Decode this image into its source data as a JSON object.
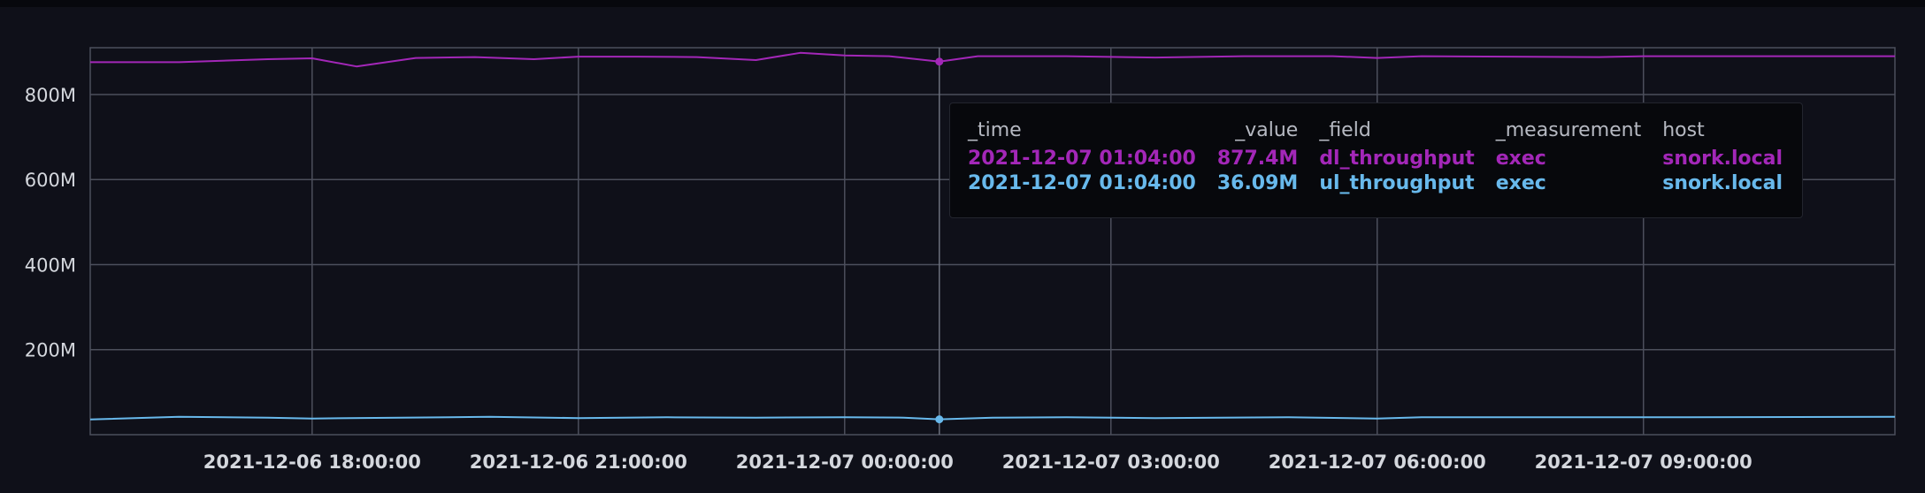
{
  "colors": {
    "background": "#0f1019",
    "grid": "#4c4f5c",
    "series_dl": "#a327b8",
    "series_ul": "#68b9ec",
    "tooltip_bg": "#07080c",
    "text": "#d4d7dd"
  },
  "tooltip": {
    "headers": [
      "_time",
      "_value",
      "_field",
      "_measurement",
      "host"
    ],
    "rows": [
      {
        "time": "2021-12-07 01:04:00",
        "value": "877.4M",
        "field": "dl_throughput",
        "measurement": "exec",
        "host": "snork.local"
      },
      {
        "time": "2021-12-07 01:04:00",
        "value": "36.09M",
        "field": "ul_throughput",
        "measurement": "exec",
        "host": "snork.local"
      }
    ]
  },
  "chart_data": {
    "type": "line",
    "title": "",
    "xlabel": "",
    "ylabel": "",
    "ylim": [
      0,
      910
    ],
    "xlim": [
      "2021-12-06 15:30:00",
      "2021-12-07 11:50:00"
    ],
    "y_ticks": [
      200,
      400,
      600,
      800
    ],
    "y_tick_labels": [
      "200M",
      "400M",
      "600M",
      "800M"
    ],
    "x_ticks": [
      "2021-12-06 18:00:00",
      "2021-12-06 21:00:00",
      "2021-12-07 00:00:00",
      "2021-12-07 03:00:00",
      "2021-12-07 06:00:00",
      "2021-12-07 09:00:00"
    ],
    "x_tick_labels": [
      "2021-12-06 18:00:00",
      "2021-12-06 21:00:00",
      "2021-12-07 00:00:00",
      "2021-12-07 03:00:00",
      "2021-12-07 06:00:00",
      "2021-12-07 09:00:00"
    ],
    "grid": true,
    "legend": "none",
    "hover_x": "2021-12-07 01:04:00",
    "series": [
      {
        "field": "dl_throughput",
        "color": "#a327b8",
        "points": [
          [
            "2021-12-06 15:30:00",
            876
          ],
          [
            "2021-12-06 16:30:00",
            876
          ],
          [
            "2021-12-06 17:30:00",
            883
          ],
          [
            "2021-12-06 18:00:00",
            885
          ],
          [
            "2021-12-06 18:30:00",
            866
          ],
          [
            "2021-12-06 19:10:00",
            886
          ],
          [
            "2021-12-06 19:50:00",
            888
          ],
          [
            "2021-12-06 20:30:00",
            883
          ],
          [
            "2021-12-06 21:00:00",
            889
          ],
          [
            "2021-12-06 21:40:00",
            889
          ],
          [
            "2021-12-06 22:20:00",
            888
          ],
          [
            "2021-12-06 23:00:00",
            881
          ],
          [
            "2021-12-06 23:30:00",
            898
          ],
          [
            "2021-12-07 00:00:00",
            892
          ],
          [
            "2021-12-07 00:30:00",
            890
          ],
          [
            "2021-12-07 01:04:00",
            877.4
          ],
          [
            "2021-12-07 01:30:00",
            890
          ],
          [
            "2021-12-07 02:30:00",
            890
          ],
          [
            "2021-12-07 03:30:00",
            887
          ],
          [
            "2021-12-07 04:30:00",
            890
          ],
          [
            "2021-12-07 05:30:00",
            890
          ],
          [
            "2021-12-07 06:00:00",
            886
          ],
          [
            "2021-12-07 06:30:00",
            890
          ],
          [
            "2021-12-07 07:30:00",
            889
          ],
          [
            "2021-12-07 08:30:00",
            888
          ],
          [
            "2021-12-07 09:00:00",
            890
          ],
          [
            "2021-12-07 10:00:00",
            890
          ],
          [
            "2021-12-07 11:50:00",
            890
          ]
        ]
      },
      {
        "field": "ul_throughput",
        "color": "#68b9ec",
        "points": [
          [
            "2021-12-06 15:30:00",
            36
          ],
          [
            "2021-12-06 16:30:00",
            42
          ],
          [
            "2021-12-06 17:30:00",
            40
          ],
          [
            "2021-12-06 18:00:00",
            38
          ],
          [
            "2021-12-06 19:00:00",
            40
          ],
          [
            "2021-12-06 20:00:00",
            42
          ],
          [
            "2021-12-06 21:00:00",
            39
          ],
          [
            "2021-12-06 22:00:00",
            41
          ],
          [
            "2021-12-06 23:00:00",
            40
          ],
          [
            "2021-12-07 00:00:00",
            41
          ],
          [
            "2021-12-07 00:40:00",
            40
          ],
          [
            "2021-12-07 01:04:00",
            36.09
          ],
          [
            "2021-12-07 01:40:00",
            40
          ],
          [
            "2021-12-07 02:30:00",
            41
          ],
          [
            "2021-12-07 03:30:00",
            39
          ],
          [
            "2021-12-07 05:00:00",
            41
          ],
          [
            "2021-12-07 06:00:00",
            38
          ],
          [
            "2021-12-07 06:30:00",
            41
          ],
          [
            "2021-12-07 08:00:00",
            41
          ],
          [
            "2021-12-07 09:30:00",
            41
          ],
          [
            "2021-12-07 11:50:00",
            42
          ]
        ]
      }
    ]
  }
}
